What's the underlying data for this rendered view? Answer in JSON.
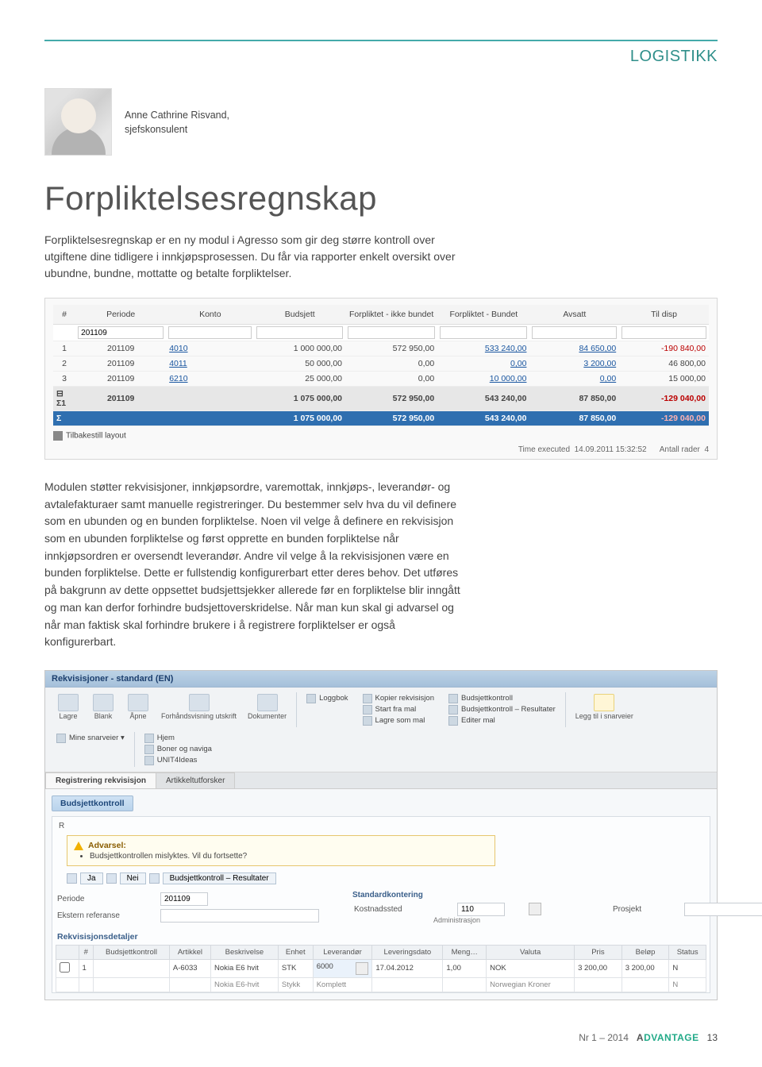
{
  "page": {
    "section_label": "LOGISTIKK"
  },
  "author": {
    "name": "Anne Cathrine Risvand,",
    "title": "sjefskonsulent"
  },
  "article": {
    "title": "Forpliktelsesregnskap",
    "lead": "Forpliktelsesregnskap er en ny modul i Agresso som gir deg større kontroll over utgiftene dine tidligere i innkjøpsprosessen. Du får via rapporter enkelt oversikt over ubundne, bundne, mottatte og betalte forpliktelser.",
    "body": "Modulen støtter rekvisisjoner, innkjøpsordre, varemottak, innkjøps-, leverandør- og avtalefakturaer samt manuelle registreringer. Du bestemmer selv hva du vil definere som en ubunden og en bunden forpliktelse. Noen vil velge å definere en rekvisisjon som en ubunden forpliktelse og først opprette en bunden forpliktelse når innkjøpsordren er oversendt leverandør. Andre vil velge å la rekvisisjonen være en bunden forpliktelse. Dette er fullstendig konfigurerbart etter deres behov. Det utføres på bakgrunn av dette oppsettet budsjettsjekker allerede før en forpliktelse blir inngått og man kan derfor forhindre budsjettoverskridelse. Når man kun skal gi advarsel og når man faktisk skal forhindre brukere i å registrere forpliktelser er også konfigurerbart."
  },
  "shot1": {
    "headers": [
      "#",
      "Periode",
      "Konto",
      "Budsjett",
      "Forpliktet - ikke bundet",
      "Forpliktet - Bundet",
      "Avsatt",
      "Til disp"
    ],
    "filter_periode": "201109",
    "rows": [
      {
        "n": "1",
        "periode": "201109",
        "konto": "4010",
        "budsjett": "1 000 000,00",
        "ikke": "572 950,00",
        "bundet": "533 240,00",
        "avsatt": "84 650,00",
        "disp": "-190 840,00",
        "neg": true
      },
      {
        "n": "2",
        "periode": "201109",
        "konto": "4011",
        "budsjett": "50 000,00",
        "ikke": "0,00",
        "bundet": "0,00",
        "avsatt": "3 200,00",
        "disp": "46 800,00",
        "neg": false
      },
      {
        "n": "3",
        "periode": "201109",
        "konto": "6210",
        "budsjett": "25 000,00",
        "ikke": "0,00",
        "bundet": "10 000,00",
        "avsatt": "0,00",
        "disp": "15 000,00",
        "neg": false
      }
    ],
    "subtotal": {
      "label": "Σ1",
      "periode": "201109",
      "budsjett": "1 075 000,00",
      "ikke": "572 950,00",
      "bundet": "543 240,00",
      "avsatt": "87 850,00",
      "disp": "-129 040,00"
    },
    "total": {
      "budsjett": "1 075 000,00",
      "ikke": "572 950,00",
      "bundet": "543 240,00",
      "avsatt": "87 850,00",
      "disp": "-129 040,00"
    },
    "reset_label": "Tilbakestill layout",
    "meta_time_label": "Time executed",
    "meta_time": "14.09.2011 15:32:52",
    "meta_count_label": "Antall rader",
    "meta_count": "4"
  },
  "shot2": {
    "title": "Rekvisisjoner - standard (EN)",
    "toolbar_main": [
      {
        "id": "save",
        "label": "Lagre"
      },
      {
        "id": "blank",
        "label": "Blank"
      },
      {
        "id": "open",
        "label": "Åpne"
      },
      {
        "id": "preview",
        "label": "Forhåndsvisning utskrift"
      },
      {
        "id": "docs",
        "label": "Dokumenter"
      }
    ],
    "toolbar_col1": [
      "Loggbok"
    ],
    "toolbar_col2": [
      "Kopier rekvisisjon",
      "Start fra mal",
      "Lagre som mal"
    ],
    "toolbar_col3": [
      "Budsjettkontroll",
      "Budsjettkontroll – Resultater",
      "Editer mal"
    ],
    "toolbar_snarvei": {
      "big": "Legg til i snarveier",
      "head": "Mine snarveier  ▾",
      "items": [
        "Hjem",
        "Boner og naviga",
        "UNIT4Ideas"
      ]
    },
    "tabs": {
      "active": "Registrering rekvisisjon",
      "inactive": "Artikkeltutforsker"
    },
    "panel": "Budsjettkontroll",
    "alert": {
      "header": "Advarsel:",
      "msg": "Budsjettkontrollen mislyktes. Vil du fortsette?"
    },
    "alert_actions": {
      "yes": "Ja",
      "no": "Nei",
      "res": "Budsjettkontroll – Resultater"
    },
    "col_right_header": "Standardkontering",
    "fields": {
      "periode_label": "Periode",
      "periode_value": "201109",
      "ekstern_label": "Ekstern referanse",
      "kostnadssted_label": "Kostnadssted",
      "kostnadssted_value": "110",
      "kostnadssted_sub": "Administrasjon",
      "prosjekt_label": "Prosjekt"
    },
    "detaljer_header": "Rekvisisjonsdetaljer",
    "detail_headers": [
      "",
      "#",
      "Budsjettkontroll",
      "Artikkel",
      "Beskrivelse",
      "Enhet",
      "Leverandør",
      "Leveringsdato",
      "Meng…",
      "Valuta",
      "Pris",
      "Beløp",
      "Status"
    ],
    "detail_row": {
      "n": "1",
      "artikkel": "A-6033",
      "besk": "Nokia E6 hvit",
      "enhet": "STK",
      "lev": "6000",
      "dato": "17.04.2012",
      "mengde": "1,00",
      "valuta": "NOK",
      "pris": "3 200,00",
      "belop": "3 200,00",
      "status": "N"
    },
    "detail_sub": {
      "besk": "Nokia E6-hvit",
      "enhet": "Stykk",
      "lev": "Komplett",
      "valuta": "Norwegian Kroner",
      "status": "N"
    }
  },
  "footer": {
    "issue": "Nr 1 – 2014",
    "brand_a": "A",
    "brand_rest": "DVANTAGE",
    "page": "13"
  }
}
